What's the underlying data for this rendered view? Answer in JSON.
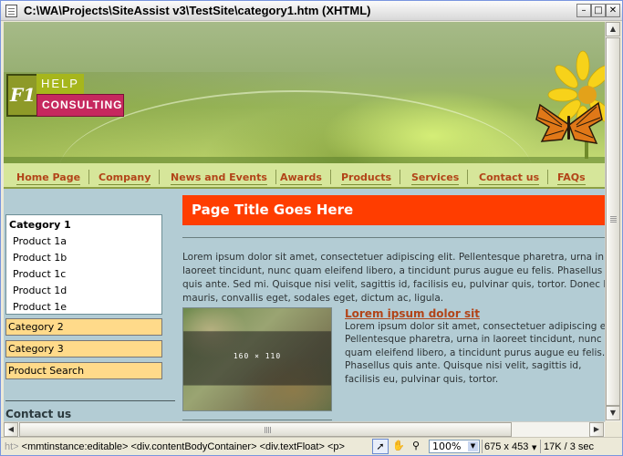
{
  "window": {
    "title": "C:\\WA\\Projects\\SiteAssist v3\\TestSite\\category1.htm (XHTML)",
    "buttons": {
      "minimize": "–",
      "maximize": "□",
      "close": "✕"
    }
  },
  "logo": {
    "f1": "F1",
    "help": "HELP",
    "consulting": "CONSULTING"
  },
  "nav": [
    "Home Page",
    "Company",
    "News and Events",
    "Awards",
    "Products",
    "Services",
    "Contact us",
    "FAQs"
  ],
  "sidebar": {
    "category1": {
      "title": "Category 1",
      "items": [
        "Product 1a",
        "Product 1b",
        "Product 1c",
        "Product 1d",
        "Product 1e"
      ]
    },
    "category2": "Category 2",
    "category3": "Category 3",
    "product_search": "Product Search",
    "contact_title": "Contact us"
  },
  "main": {
    "page_title": "Page Title Goes Here",
    "paragraph": "Lorem ipsum dolor sit amet, consectetuer adipiscing elit. Pellentesque pharetra, urna in laoreet tincidunt, nunc quam eleifend libero, a tincidunt purus augue eu felis. Phasellus quis ante. Sed mi. Quisque nisi velit, sagittis id, facilisis eu, pulvinar quis, tortor. Donec leo mauris, convallis eget, sodales eget, dictum ac, ligula.",
    "image_placeholder": "160 × 110",
    "sub_heading": "Lorem ipsum dolor sit",
    "sub_paragraph": "Lorem ipsum dolor sit amet, consectetuer adipiscing elit. Pellentesque pharetra, urna in laoreet tincidunt, nunc quam eleifend libero, a tincidunt purus augue eu felis. Phasellus quis ante. Quisque nisi velit, sagittis id, facilisis eu, pulvinar quis, tortor."
  },
  "statusbar": {
    "tag_prefix": "ht>",
    "tag_path": " <mmtinstance:editable> <div.contentBodyContainer> <div.textFloat> <p>",
    "zoom": "100%",
    "window_size": "675 x 453",
    "download_info": "17K / 3 sec"
  },
  "colors": {
    "accent_orange": "#ff3d00",
    "link_rust": "#b24418",
    "nav_bg": "#d6e69a",
    "content_bg": "#b3ccd4",
    "sidebar_box": "#ffda8a",
    "logo_pink": "#c6285e",
    "logo_green": "#a6b61c"
  }
}
